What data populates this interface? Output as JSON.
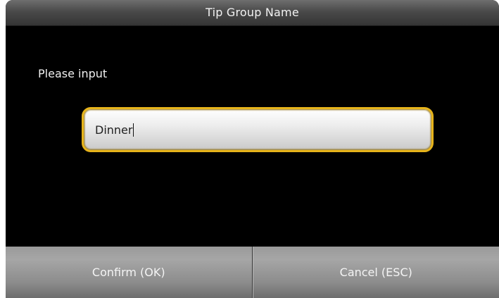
{
  "dialog": {
    "title": "Tip Group Name",
    "prompt": "Please input"
  },
  "input": {
    "value": "Dinner"
  },
  "buttons": {
    "confirm_label": "Confirm (OK)",
    "cancel_label": "Cancel (ESC)"
  },
  "colors": {
    "background": "#000000",
    "input_border_accent": "#e7b41b",
    "button_gray": "#9a9a9a"
  }
}
